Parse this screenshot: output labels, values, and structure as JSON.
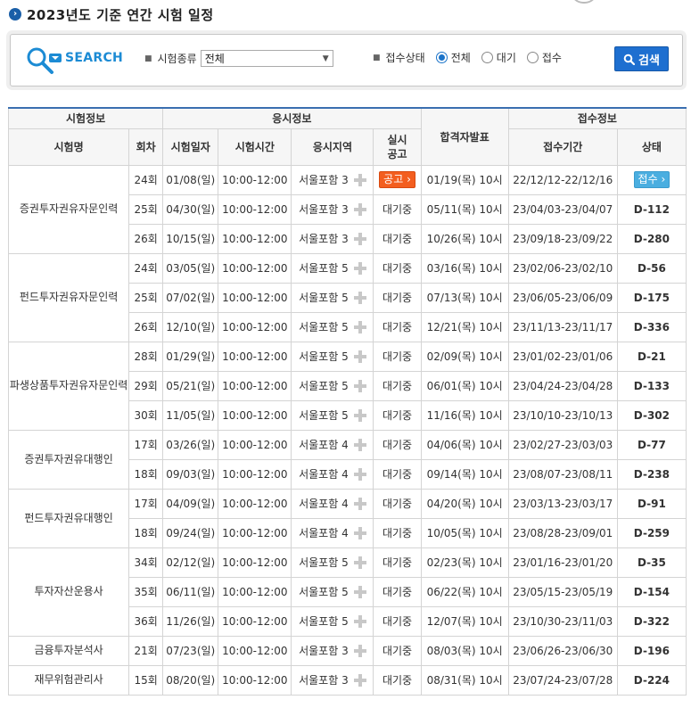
{
  "page": {
    "title": "2023년도 기준 연간 시험 일정"
  },
  "search": {
    "logo": "SEARCH",
    "exam_type_label": "시험종류",
    "exam_type_value": "전체",
    "status_label": "접수상태",
    "radio_all": "전체",
    "radio_wait": "대기",
    "radio_open": "접수",
    "search_button": "검색"
  },
  "table": {
    "group_exam": "시험정보",
    "group_test": "응시정보",
    "group_reg": "접수정보",
    "col_name": "시험명",
    "col_round": "회차",
    "col_date": "시험일자",
    "col_time": "시험시간",
    "col_region": "응시지역",
    "col_notice_1": "실시",
    "col_notice_2": "공고",
    "col_result": "합격자발표",
    "col_period": "접수기간",
    "col_status": "상태",
    "exams": [
      {
        "name": "증권투자권유자문인력",
        "rows": [
          {
            "round": "24회",
            "date": "01/08(일)",
            "time": "10:00-12:00",
            "region": "서울포함 3",
            "notice": "공고",
            "notice_type": "button",
            "result": "01/19(목) 10시",
            "period": "22/12/12-22/12/16",
            "status": "접수",
            "status_type": "button"
          },
          {
            "round": "25회",
            "date": "04/30(일)",
            "time": "10:00-12:00",
            "region": "서울포함 3",
            "notice": "대기중",
            "notice_type": "text",
            "result": "05/11(목) 10시",
            "period": "23/04/03-23/04/07",
            "status": "D-112",
            "status_type": "dday"
          },
          {
            "round": "26회",
            "date": "10/15(일)",
            "time": "10:00-12:00",
            "region": "서울포함 3",
            "notice": "대기중",
            "notice_type": "text",
            "result": "10/26(목) 10시",
            "period": "23/09/18-23/09/22",
            "status": "D-280",
            "status_type": "dday"
          }
        ]
      },
      {
        "name": "펀드투자권유자문인력",
        "rows": [
          {
            "round": "24회",
            "date": "03/05(일)",
            "time": "10:00-12:00",
            "region": "서울포함 5",
            "notice": "대기중",
            "notice_type": "text",
            "result": "03/16(목) 10시",
            "period": "23/02/06-23/02/10",
            "status": "D-56",
            "status_type": "dday"
          },
          {
            "round": "25회",
            "date": "07/02(일)",
            "time": "10:00-12:00",
            "region": "서울포함 5",
            "notice": "대기중",
            "notice_type": "text",
            "result": "07/13(목) 10시",
            "period": "23/06/05-23/06/09",
            "status": "D-175",
            "status_type": "dday"
          },
          {
            "round": "26회",
            "date": "12/10(일)",
            "time": "10:00-12:00",
            "region": "서울포함 5",
            "notice": "대기중",
            "notice_type": "text",
            "result": "12/21(목) 10시",
            "period": "23/11/13-23/11/17",
            "status": "D-336",
            "status_type": "dday"
          }
        ]
      },
      {
        "name": "파생상품투자권유자문인력",
        "rows": [
          {
            "round": "28회",
            "date": "01/29(일)",
            "time": "10:00-12:00",
            "region": "서울포함 5",
            "notice": "대기중",
            "notice_type": "text",
            "result": "02/09(목) 10시",
            "period": "23/01/02-23/01/06",
            "status": "D-21",
            "status_type": "dday"
          },
          {
            "round": "29회",
            "date": "05/21(일)",
            "time": "10:00-12:00",
            "region": "서울포함 5",
            "notice": "대기중",
            "notice_type": "text",
            "result": "06/01(목) 10시",
            "period": "23/04/24-23/04/28",
            "status": "D-133",
            "status_type": "dday"
          },
          {
            "round": "30회",
            "date": "11/05(일)",
            "time": "10:00-12:00",
            "region": "서울포함 5",
            "notice": "대기중",
            "notice_type": "text",
            "result": "11/16(목) 10시",
            "period": "23/10/10-23/10/13",
            "status": "D-302",
            "status_type": "dday"
          }
        ]
      },
      {
        "name": "증권투자권유대행인",
        "rows": [
          {
            "round": "17회",
            "date": "03/26(일)",
            "time": "10:00-12:00",
            "region": "서울포함 4",
            "notice": "대기중",
            "notice_type": "text",
            "result": "04/06(목) 10시",
            "period": "23/02/27-23/03/03",
            "status": "D-77",
            "status_type": "dday"
          },
          {
            "round": "18회",
            "date": "09/03(일)",
            "time": "10:00-12:00",
            "region": "서울포함 4",
            "notice": "대기중",
            "notice_type": "text",
            "result": "09/14(목) 10시",
            "period": "23/08/07-23/08/11",
            "status": "D-238",
            "status_type": "dday"
          }
        ]
      },
      {
        "name": "펀드투자권유대행인",
        "rows": [
          {
            "round": "17회",
            "date": "04/09(일)",
            "time": "10:00-12:00",
            "region": "서울포함 4",
            "notice": "대기중",
            "notice_type": "text",
            "result": "04/20(목) 10시",
            "period": "23/03/13-23/03/17",
            "status": "D-91",
            "status_type": "dday"
          },
          {
            "round": "18회",
            "date": "09/24(일)",
            "time": "10:00-12:00",
            "region": "서울포함 4",
            "notice": "대기중",
            "notice_type": "text",
            "result": "10/05(목) 10시",
            "period": "23/08/28-23/09/01",
            "status": "D-259",
            "status_type": "dday"
          }
        ]
      },
      {
        "name": "투자자산운용사",
        "rows": [
          {
            "round": "34회",
            "date": "02/12(일)",
            "time": "10:00-12:00",
            "region": "서울포함 5",
            "notice": "대기중",
            "notice_type": "text",
            "result": "02/23(목) 10시",
            "period": "23/01/16-23/01/20",
            "status": "D-35",
            "status_type": "dday"
          },
          {
            "round": "35회",
            "date": "06/11(일)",
            "time": "10:00-12:00",
            "region": "서울포함 5",
            "notice": "대기중",
            "notice_type": "text",
            "result": "06/22(목) 10시",
            "period": "23/05/15-23/05/19",
            "status": "D-154",
            "status_type": "dday"
          },
          {
            "round": "36회",
            "date": "11/26(일)",
            "time": "10:00-12:00",
            "region": "서울포함 5",
            "notice": "대기중",
            "notice_type": "text",
            "result": "12/07(목) 10시",
            "period": "23/10/30-23/11/03",
            "status": "D-322",
            "status_type": "dday"
          }
        ]
      },
      {
        "name": "금융투자분석사",
        "rows": [
          {
            "round": "21회",
            "date": "07/23(일)",
            "time": "10:00-12:00",
            "region": "서울포함 3",
            "notice": "대기중",
            "notice_type": "text",
            "result": "08/03(목) 10시",
            "period": "23/06/26-23/06/30",
            "status": "D-196",
            "status_type": "dday"
          }
        ]
      },
      {
        "name": "재무위험관리사",
        "rows": [
          {
            "round": "15회",
            "date": "08/20(일)",
            "time": "10:00-12:00",
            "region": "서울포함 3",
            "notice": "대기중",
            "notice_type": "text",
            "result": "08/31(목) 10시",
            "period": "23/07/24-23/07/28",
            "status": "D-224",
            "status_type": "dday"
          }
        ]
      }
    ]
  }
}
